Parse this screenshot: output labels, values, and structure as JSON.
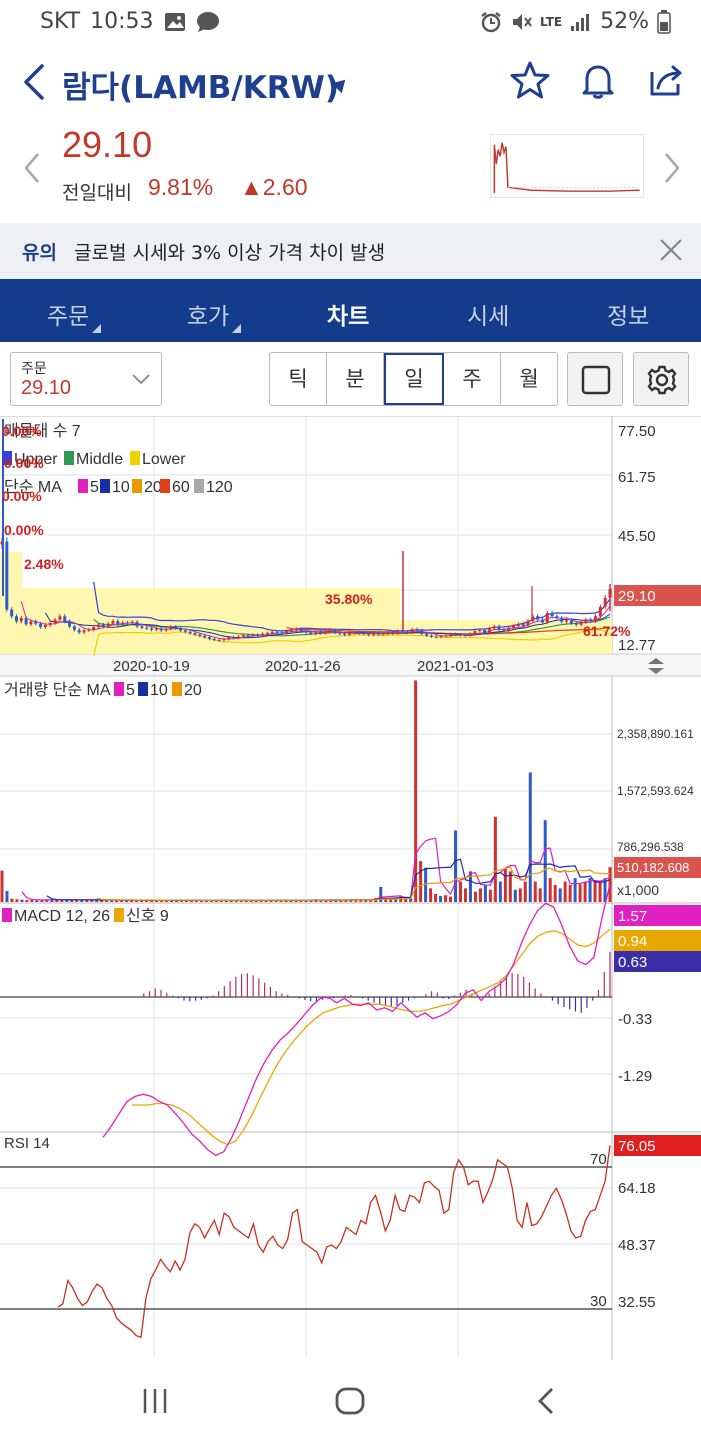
{
  "status": {
    "carrier": "SKT",
    "time": "10:53",
    "network": "LTE",
    "battery": "52%"
  },
  "header": {
    "title": "람다(LAMB/KRW)"
  },
  "price": {
    "value": "29.10",
    "change_label": "전일대비",
    "change_pct": "9.81%",
    "change_amt": "▲2.60"
  },
  "notice": {
    "tag": "유의",
    "message": "글로벌 시세와 3% 이상 가격 차이 발생"
  },
  "tabs": [
    {
      "label": "주문"
    },
    {
      "label": "호가"
    },
    {
      "label": "차트"
    },
    {
      "label": "시세"
    },
    {
      "label": "정보"
    }
  ],
  "controls": {
    "select_label": "주문",
    "select_value": "29.10",
    "periods": [
      "틱",
      "분",
      "일",
      "주",
      "월"
    ],
    "active_period": "일"
  },
  "chart_data": [
    {
      "type": "line",
      "title": "",
      "legend": [
        {
          "label": "매물대 수 7"
        },
        {
          "label": "Upper",
          "color": "#3344dd"
        },
        {
          "label": "Middle",
          "color": "#2e9950"
        },
        {
          "label": "Lower",
          "color": "#f0d000"
        }
      ],
      "ma_legend": {
        "prefix": "단순 MA",
        "items": [
          {
            "label": "5",
            "color": "#e020c0"
          },
          {
            "label": "10",
            "color": "#1b2fa5"
          },
          {
            "label": "20",
            "color": "#e89a00"
          },
          {
            "label": "60",
            "color": "#e0401a"
          },
          {
            "label": "120",
            "color": "#a8a8a8"
          }
        ]
      },
      "x_ticks": [
        "2020-10-19",
        "2020-11-26",
        "2021-01-03"
      ],
      "y_ticks": [
        "77.50",
        "61.75",
        "45.50",
        "12.77"
      ],
      "last_price_label": "29.10",
      "ylim": [
        12.77,
        77.5
      ],
      "volume_profile_labels": [
        "0.00%",
        "0.00%",
        "0.00%",
        "0.00%",
        "2.48%",
        "35.80%",
        "61.72%"
      ],
      "close": [
        43.2,
        23.0,
        21.0,
        19.5,
        20.5,
        18.6,
        19.5,
        18.8,
        17.8,
        18.4,
        19.0,
        20.0,
        21.0,
        19.5,
        18.0,
        17.0,
        16.2,
        16.8,
        17.0,
        17.8,
        18.5,
        18.0,
        18.8,
        19.6,
        18.6,
        19.1,
        18.9,
        19.3,
        18.0,
        17.6,
        17.4,
        17.0,
        17.3,
        16.8,
        17.2,
        17.9,
        17.5,
        16.8,
        16.4,
        16.0,
        15.6,
        15.2,
        14.8,
        14.3,
        14.0,
        13.9,
        14.2,
        14.8,
        14.6,
        15.0,
        15.4,
        15.2,
        15.5,
        15.3,
        15.8,
        16.0,
        16.4,
        16.2,
        16.0,
        16.6,
        16.8,
        17.2,
        16.6,
        16.2,
        15.8,
        16.2,
        16.0,
        16.5,
        16.7,
        16.1,
        15.8,
        15.5,
        16.0,
        16.2,
        16.0,
        15.8,
        15.5,
        15.9,
        15.7,
        15.9,
        16.1,
        15.9,
        16.6,
        16.4,
        16.2,
        17.1,
        16.8,
        15.8,
        15.3,
        15.0,
        14.9,
        15.1,
        15.3,
        15.7,
        15.6,
        15.4,
        15.2,
        15.8,
        16.6,
        16.9,
        16.2,
        17.4,
        18.0,
        17.1,
        16.8,
        17.6,
        18.1,
        18.7,
        18.2,
        19.6,
        21.0,
        20.0,
        19.2,
        22.0,
        21.0,
        20.5,
        19.4,
        19.8,
        19.0,
        18.5,
        19.3,
        20.0,
        19.6,
        21.0,
        23.8,
        26.5,
        29.1
      ]
    },
    {
      "type": "bar",
      "title": "거래량 단순 MA",
      "legend": [
        {
          "label": "5",
          "color": "#e020c0"
        },
        {
          "label": "10",
          "color": "#1b2fa5"
        },
        {
          "label": "20",
          "color": "#e89a00"
        }
      ],
      "y_ticks": [
        "2,358,890.161",
        "1,572,593.624",
        "786,296.538"
      ],
      "unit": "x1,000",
      "last_value_label": "510,182.608",
      "values": [
        460,
        160,
        50,
        40,
        35,
        30,
        30,
        25,
        30,
        40,
        35,
        30,
        30,
        35,
        40,
        30,
        25,
        30,
        25,
        35,
        30,
        25,
        30,
        20,
        35,
        25,
        30,
        20,
        25,
        30,
        25,
        20,
        30,
        25,
        20,
        30,
        25,
        30,
        20,
        25,
        20,
        30,
        25,
        20,
        25,
        30,
        25,
        20,
        30,
        25,
        20,
        30,
        25,
        20,
        30,
        25,
        30,
        20,
        25,
        30,
        25,
        20,
        30,
        40,
        30,
        25,
        30,
        35,
        30,
        25,
        40,
        35,
        30,
        25,
        35,
        60,
        220,
        40,
        50,
        60,
        80,
        70,
        60,
        3250,
        600,
        500,
        200,
        120,
        90,
        100,
        80,
        1050,
        300,
        200,
        450,
        150,
        200,
        250,
        180,
        1250,
        300,
        500,
        450,
        180,
        200,
        300,
        1900,
        300,
        200,
        1200,
        350,
        250,
        200,
        300,
        250,
        350,
        260,
        300,
        350,
        320,
        300,
        350,
        510
      ]
    },
    {
      "type": "line",
      "title": "MACD 12, 26",
      "legend": [
        {
          "label": "MACD 12, 26",
          "color": "#e020c0"
        },
        {
          "label": "신호 9",
          "color": "#e8a800"
        }
      ],
      "y_ticks": [
        "-0.33",
        "-1.29"
      ],
      "last_value_labels": [
        {
          "value": "1.57",
          "color": "#e020c0"
        },
        {
          "value": "0.94",
          "color": "#e8a800"
        },
        {
          "value": "0.63",
          "color": "#3a2fa8"
        }
      ],
      "ylim": [
        -2.2,
        1.7
      ],
      "macd": [
        -1.95,
        -1.8,
        -1.62,
        -1.45,
        -1.38,
        -1.35,
        -1.38,
        -1.45,
        -1.5,
        -1.62,
        -1.75,
        -1.9,
        -2.0,
        -2.12,
        -2.2,
        -2.15,
        -1.95,
        -1.7,
        -1.42,
        -1.15,
        -0.92,
        -0.74,
        -0.6,
        -0.5,
        -0.38,
        -0.25,
        -0.12,
        -0.02,
        0.0,
        -0.08,
        -0.02,
        -0.1,
        -0.12,
        -0.08,
        -0.18,
        -0.15,
        -0.2,
        -0.08,
        -0.18,
        -0.28,
        -0.22,
        -0.3,
        -0.26,
        -0.2,
        -0.1,
        0.05,
        0.1,
        -0.05,
        0.08,
        0.15,
        0.25,
        0.45,
        0.75,
        1.0,
        1.2,
        1.3,
        1.25,
        1.0,
        0.7,
        0.5,
        0.45,
        0.55,
        1.1,
        1.57
      ],
      "signal": [
        -1.5,
        -1.5,
        -1.5,
        -1.48,
        -1.48,
        -1.5,
        -1.55,
        -1.62,
        -1.72,
        -1.82,
        -1.92,
        -2.0,
        -2.05,
        -2.0,
        -1.85,
        -1.65,
        -1.42,
        -1.2,
        -0.98,
        -0.8,
        -0.65,
        -0.52,
        -0.4,
        -0.3,
        -0.22,
        -0.18,
        -0.14,
        -0.12,
        -0.1,
        -0.1,
        -0.1,
        -0.1,
        -0.12,
        -0.15,
        -0.18,
        -0.2,
        -0.2,
        -0.18,
        -0.15,
        -0.12,
        -0.1,
        -0.05,
        0.0,
        0.05,
        0.1,
        0.15,
        0.2,
        0.3,
        0.45,
        0.6,
        0.75,
        0.85,
        0.9,
        0.92,
        0.88,
        0.8,
        0.72,
        0.7,
        0.75,
        0.85,
        0.94
      ],
      "histogram": [
        0.0,
        0.05,
        0.08,
        0.12,
        0.1,
        0.06,
        0.02,
        -0.02,
        -0.05,
        -0.06,
        -0.05,
        -0.04,
        -0.02,
        0.02,
        0.08,
        0.15,
        0.22,
        0.28,
        0.32,
        0.33,
        0.3,
        0.26,
        0.2,
        0.14,
        0.08,
        0.05,
        0.03,
        0.01,
        -0.02,
        -0.04,
        -0.06,
        -0.06,
        -0.04,
        -0.03,
        -0.02,
        0.0,
        0.02,
        0.03,
        0.01,
        -0.02,
        -0.05,
        -0.08,
        -0.1,
        -0.12,
        -0.14,
        -0.12,
        -0.08,
        -0.05,
        -0.02,
        0.0,
        0.04,
        0.08,
        0.06,
        -0.02,
        -0.03,
        0.02,
        0.06,
        0.1,
        0.05,
        0.0,
        -0.02,
        0.05,
        0.15,
        0.24,
        0.3,
        0.33,
        0.32,
        0.28,
        0.2,
        0.12,
        0.05,
        0.0,
        -0.05,
        -0.1,
        -0.14,
        -0.17,
        -0.2,
        -0.22,
        -0.15,
        -0.05,
        0.1,
        0.35,
        0.63
      ]
    },
    {
      "type": "line",
      "title": "RSI 14",
      "y_ticks": [
        "64.18",
        "48.37",
        "32.55"
      ],
      "threshold_labels": [
        "70",
        "30"
      ],
      "thresholds": [
        70,
        30
      ],
      "last_value_label": "76.05",
      "ylim": [
        22,
        76.05
      ],
      "values": [
        30.5,
        31.5,
        38.0,
        36.0,
        33.0,
        31.0,
        32.0,
        35.0,
        37.0,
        36.0,
        33.0,
        31.0,
        27.5,
        26.0,
        25.0,
        24.0,
        22.5,
        22.0,
        33.0,
        38.5,
        41.0,
        44.0,
        42.0,
        40.5,
        43.5,
        41.0,
        44.0,
        51.5,
        54.0,
        53.0,
        50.0,
        52.5,
        55.0,
        51.0,
        57.0,
        56.0,
        53.0,
        52.0,
        51.0,
        50.0,
        54.0,
        48.0,
        46.0,
        49.0,
        50.5,
        48.0,
        47.0,
        49.5,
        57.0,
        58.0,
        49.0,
        48.0,
        47.0,
        46.0,
        43.0,
        47.5,
        48.0,
        47.0,
        49.0,
        53.0,
        52.0,
        51.0,
        55.0,
        54.0,
        60.0,
        62.0,
        57.5,
        52.0,
        55.0,
        62.0,
        58.0,
        57.5,
        62.0,
        61.5,
        60.0,
        65.5,
        66.0,
        64.5,
        63.5,
        57.0,
        58.0,
        68.5,
        72.0,
        70.0,
        65.0,
        66.0,
        66.0,
        60.0,
        63.0,
        66.5,
        72.0,
        71.0,
        70.0,
        64.0,
        55.0,
        53.0,
        60.0,
        53.5,
        54.0,
        56.0,
        59.0,
        62.0,
        64.0,
        61.0,
        57.0,
        52.0,
        50.0,
        50.5,
        55.0,
        57.5,
        58.0,
        62.0,
        66.0,
        76.05
      ]
    }
  ]
}
